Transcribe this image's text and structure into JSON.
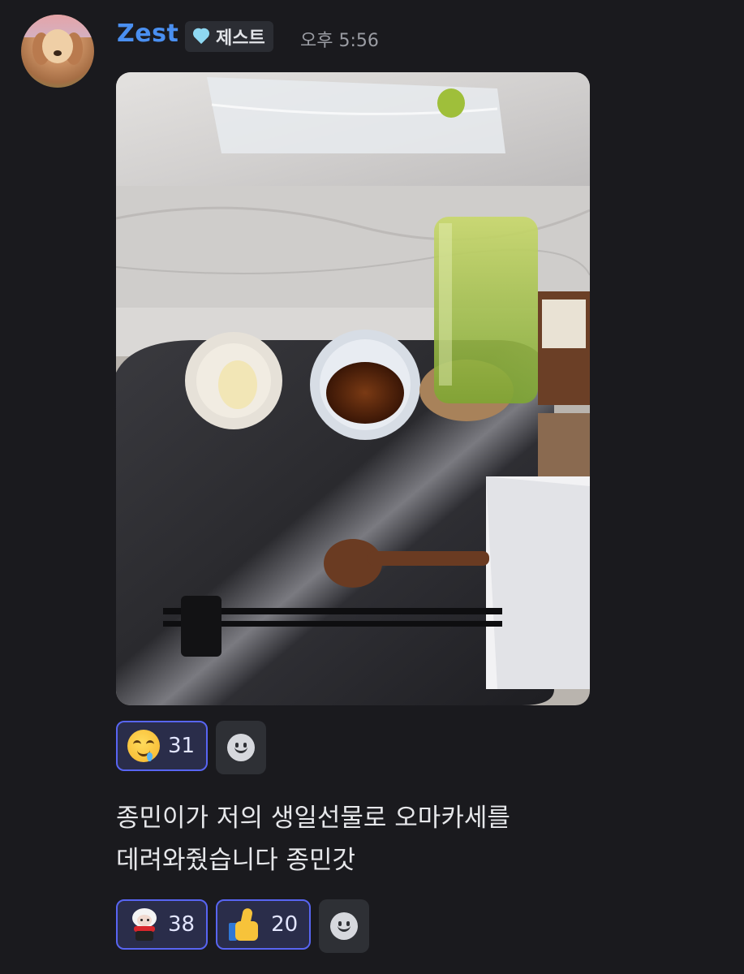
{
  "message": {
    "author": "Zest",
    "role_tag": "제스트",
    "role_icon": "gem-heart-icon",
    "timestamp": "오후 5:56",
    "text_line1": "종민이가 저의 생일선물로 오마카세를",
    "text_line2": "데려와줬습니다 종민갓",
    "image_reactions": [
      {
        "emoji": "drooling-face-icon",
        "count": "31"
      }
    ],
    "text_reactions": [
      {
        "emoji": "sheep-sticker-icon",
        "count": "38"
      },
      {
        "emoji": "thumbs-up-icon",
        "count": "20"
      }
    ],
    "add_reaction_icon": "add-reaction-icon"
  },
  "colors": {
    "background": "#1a1a1e",
    "username": "#4a8ff0",
    "reaction_active_border": "#5865f2",
    "reaction_active_bg": "#2a2d4a"
  }
}
